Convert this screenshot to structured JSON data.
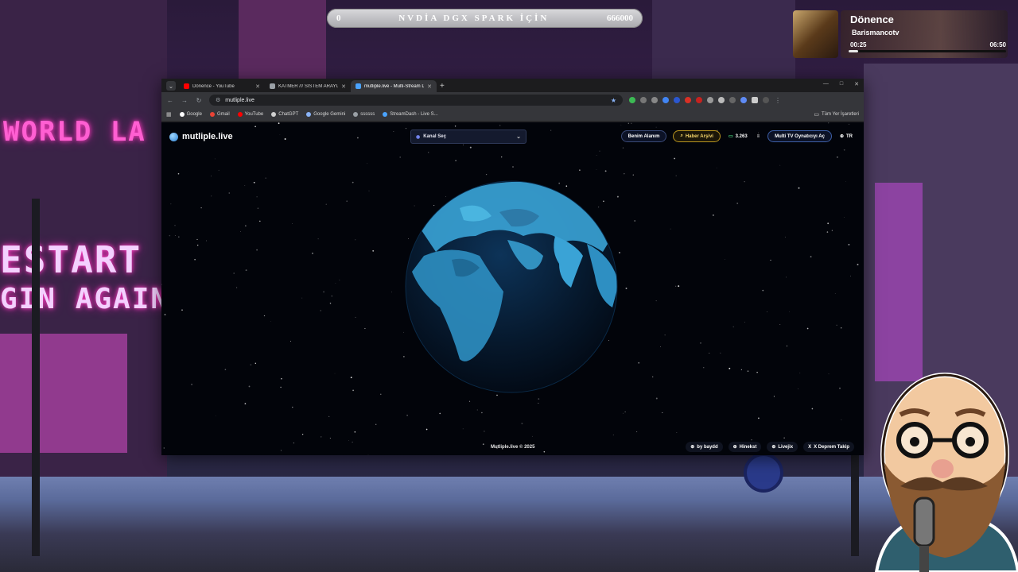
{
  "banner": {
    "left_value": "0",
    "title": "NVDİA DGX SPARK İÇİN",
    "right_value": "666000"
  },
  "now_playing": {
    "title": "Dönence",
    "artist": "Barismancotv",
    "elapsed": "00:25",
    "duration": "06:50",
    "progress": 0.06
  },
  "background": {
    "sign_world": "WORLD LA",
    "sign_restart": "ESTART",
    "sign_again": "GIN AGAIN"
  },
  "browser": {
    "tabs": [
      {
        "label": "Dönence - YouTube",
        "favicon_color": "#ff0000",
        "active": false
      },
      {
        "label": "KATMER /// SİSTEM ARAYÜZÜ",
        "favicon_color": "#9aa0a6",
        "active": false
      },
      {
        "label": "mutliple.live - Multi-Stream Dis",
        "favicon_color": "#4aa3ff",
        "active": true
      }
    ],
    "url": "mutliple.live",
    "bookmarks": [
      {
        "label": "Google",
        "color": "#ffffff"
      },
      {
        "label": "Gmail",
        "color": "#ea4335"
      },
      {
        "label": "YouTube",
        "color": "#ff0000"
      },
      {
        "label": "ChatGPT",
        "color": "#d0d0d0"
      },
      {
        "label": "Google Gemini",
        "color": "#8ab4f8"
      },
      {
        "label": "ssssss",
        "color": "#9aa0a6"
      },
      {
        "label": "StreamDash - Live S...",
        "color": "#4aa3ff"
      }
    ],
    "all_bookmarks": "Tüm Yer İşaretleri"
  },
  "site": {
    "brand": "mutliple.live",
    "channel_select": "Kanal Seç",
    "nav": {
      "my_area": "Benim Alanım",
      "news_archive": "Haber Arşivi",
      "viewer_count": "3.263",
      "multi_tv": "Multi TV Oynatıcıyı Aç",
      "language": "TR"
    },
    "footer_copy": "Mutliple.live © 2025",
    "footer_links": [
      "by baydd",
      "Hinekst",
      "Livejix",
      "X Deprem Takip"
    ]
  },
  "colors": {
    "accent": "#2c7fd0",
    "news": "#f3d36a",
    "globe_land": "#3aa3d6",
    "globe_ocean": "#06182c"
  }
}
